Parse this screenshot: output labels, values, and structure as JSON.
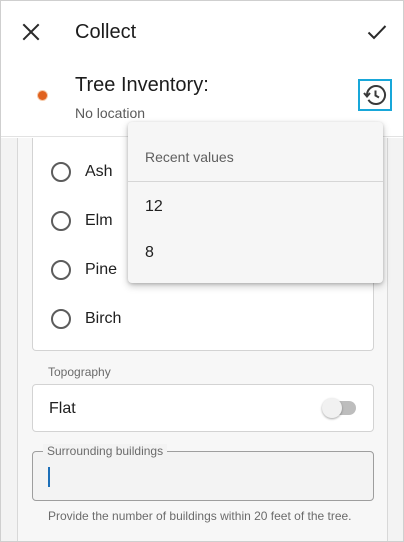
{
  "appbar": {
    "title": "Collect",
    "close_icon": "close-icon",
    "check_icon": "check-icon"
  },
  "feature": {
    "name": "Tree Inventory:",
    "location": "No location",
    "marker_color": "#e0611e",
    "history_icon": "history-icon"
  },
  "species_options": [
    {
      "label": "Ash"
    },
    {
      "label": "Elm"
    },
    {
      "label": "Pine"
    },
    {
      "label": "Birch"
    }
  ],
  "topography": {
    "label": "Topography",
    "value": "Flat",
    "toggle_on": false
  },
  "surrounding_buildings": {
    "label": "Surrounding buildings",
    "value": "",
    "help": "Provide the number of buildings within 20 feet of the tree."
  },
  "recent_values": {
    "header": "Recent values",
    "items": [
      "12",
      "8"
    ]
  },
  "colors": {
    "focus_outline": "#18a7d9",
    "caret": "#1d6fb8"
  }
}
